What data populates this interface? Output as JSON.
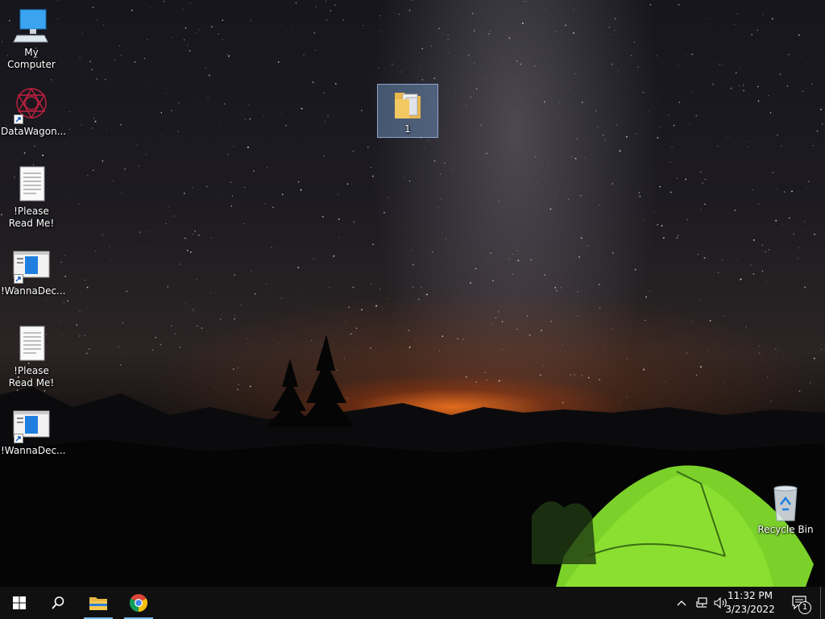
{
  "desktop": {
    "icons": [
      {
        "label": "My Computer",
        "icon": "computer-icon"
      },
      {
        "label": "DataWagon...",
        "icon": "datawagon-icon"
      },
      {
        "label": "!Please Read Me!",
        "icon": "text-document-icon"
      },
      {
        "label": "!WannaDec...",
        "icon": "wannadecryptor-icon"
      },
      {
        "label": "!Please Read Me!",
        "icon": "text-document-icon"
      },
      {
        "label": "!WannaDec...",
        "icon": "wannadecryptor-icon"
      }
    ],
    "folder": {
      "label": "1",
      "icon": "folder-icon",
      "selected": true
    },
    "recycle_bin": {
      "label": "Recycle Bin",
      "icon": "recycle-bin-icon"
    }
  },
  "taskbar": {
    "pinned": [
      {
        "name": "start",
        "icon": "windows-logo-icon"
      },
      {
        "name": "search",
        "icon": "search-icon"
      },
      {
        "name": "file-explorer",
        "icon": "folder-icon",
        "active": true
      },
      {
        "name": "chrome",
        "icon": "chrome-icon",
        "active": true
      }
    ],
    "tray": {
      "time": "11:32 PM",
      "date": "3/23/2022",
      "notification_count": "1",
      "icons": [
        "chevron-up-icon",
        "network-icon",
        "volume-icon"
      ]
    }
  },
  "colors": {
    "selection": "#78a0d2",
    "taskbar": "#101010",
    "accent": "#76b9ed"
  }
}
